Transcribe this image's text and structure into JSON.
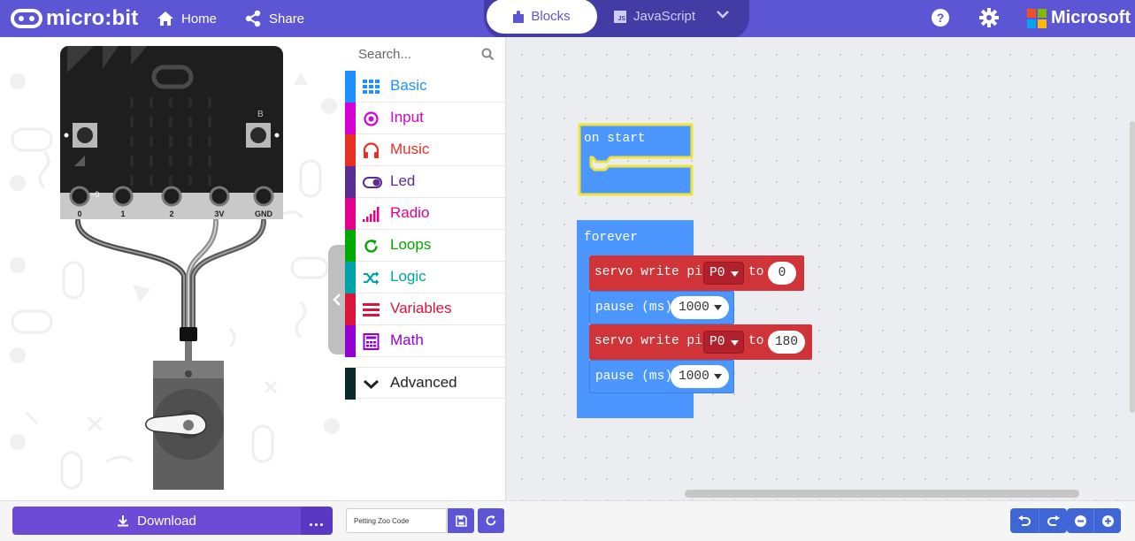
{
  "header": {
    "logo_text": "micro:bit",
    "nav": {
      "home_label": "Home",
      "share_label": "Share"
    },
    "mode": {
      "blocks_label": "Blocks",
      "javascript_label": "JavaScript",
      "js_badge": "JS"
    },
    "brand": "Microsoft"
  },
  "simulator": {
    "pin_labels": [
      "0",
      "1",
      "2",
      "3V",
      "GND"
    ],
    "button_labels": {
      "b": "B"
    },
    "pin0_marker": "~0"
  },
  "toolbox": {
    "search_placeholder": "Search...",
    "categories": [
      {
        "label": "Basic",
        "color": "#1e90ff"
      },
      {
        "label": "Input",
        "color": "#d400d4"
      },
      {
        "label": "Music",
        "color": "#e63022"
      },
      {
        "label": "Led",
        "color": "#5c2d91"
      },
      {
        "label": "Radio",
        "color": "#e3008c"
      },
      {
        "label": "Loops",
        "color": "#00aa00"
      },
      {
        "label": "Logic",
        "color": "#00a4a6"
      },
      {
        "label": "Variables",
        "color": "#dc143c"
      },
      {
        "label": "Math",
        "color": "#9400d3"
      },
      {
        "label": "Advanced",
        "color": "#2b2b2b"
      }
    ]
  },
  "workspace": {
    "on_start": {
      "label": "on start"
    },
    "forever": {
      "label": "forever",
      "statements": [
        {
          "text": "servo write pin",
          "pin": "P0",
          "to_label": "to",
          "value": "0"
        },
        {
          "text": "pause (ms)",
          "value": "1000"
        },
        {
          "text": "servo write pin",
          "pin": "P0",
          "to_label": "to",
          "value": "180"
        },
        {
          "text": "pause (ms)",
          "value": "1000"
        }
      ]
    }
  },
  "bottombar": {
    "download_label": "Download",
    "more_label": "...",
    "project_name": "Petting Zoo Code"
  },
  "colors": {
    "header": "#5c55d4",
    "basic_block": "#4c97ff",
    "servo_block": "#d13438",
    "workspace_bg": "#ecedf0"
  }
}
